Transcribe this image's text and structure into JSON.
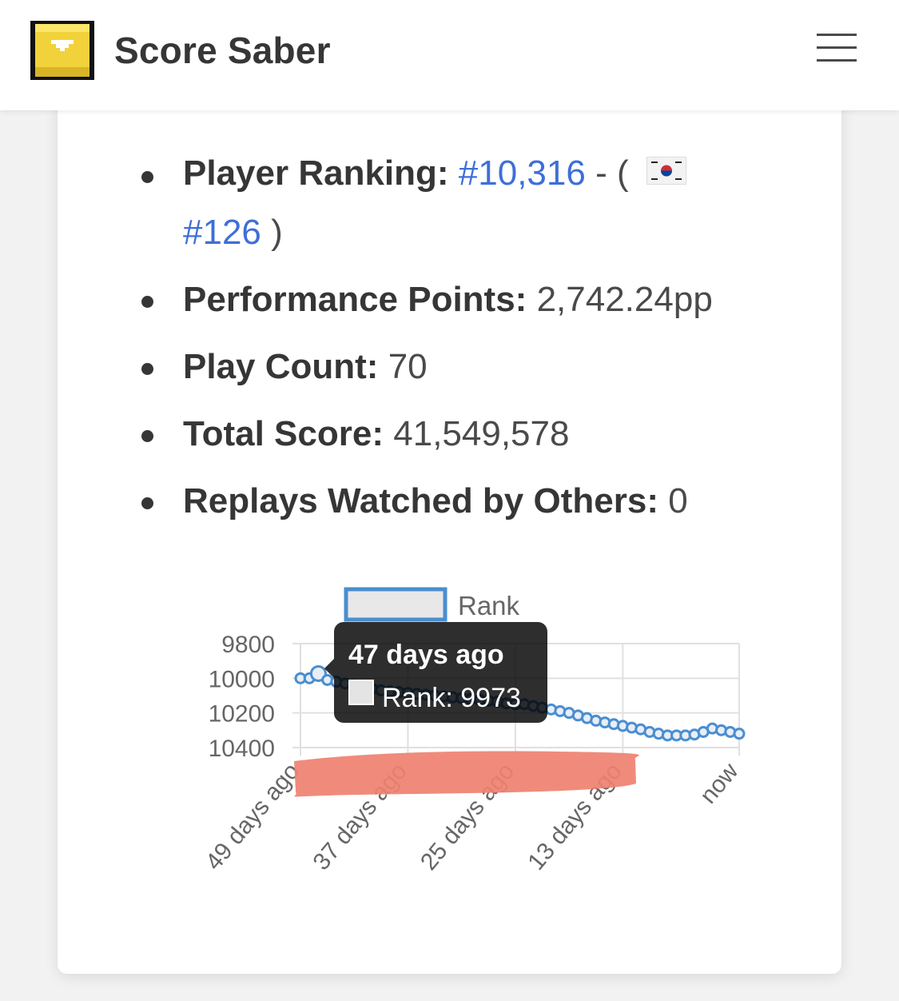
{
  "header": {
    "brand": "Score Saber",
    "logo_icon": "pixel-cube-logo-icon",
    "menu_icon": "hamburger-menu-icon"
  },
  "stats": {
    "player_ranking_label": "Player Ranking:",
    "player_ranking_value": "#10,316",
    "separator": " - ( ",
    "country_flag_icon": "south-korea-flag-icon",
    "country_rank_value": "#126",
    "country_rank_close": " )",
    "performance_points_label": "Performance Points:",
    "performance_points_value": "2,742.24pp",
    "play_count_label": "Play Count:",
    "play_count_value": "70",
    "total_score_label": "Total Score:",
    "total_score_value": "41,549,578",
    "replays_label": "Replays Watched by Others:",
    "replays_value": "0"
  },
  "chart_data": {
    "type": "line",
    "legend": "Rank",
    "y_reversed": true,
    "ylim": [
      9800,
      10400
    ],
    "y_ticks": [
      "9800",
      "10000",
      "10200",
      "10400"
    ],
    "x_ticks": [
      "49 days ago",
      "37 days ago",
      "25 days ago",
      "13 days ago",
      "now"
    ],
    "series": [
      {
        "name": "Rank",
        "color": "#4a8ed0",
        "x": [
          49,
          48,
          47,
          46,
          45,
          44,
          43,
          42,
          41,
          40,
          39,
          38,
          37,
          36,
          35,
          34,
          33,
          32,
          31,
          30,
          29,
          28,
          27,
          26,
          25,
          24,
          23,
          22,
          21,
          20,
          19,
          18,
          17,
          16,
          15,
          14,
          13,
          12,
          11,
          10,
          9,
          8,
          7,
          6,
          5,
          4,
          3,
          2,
          1,
          0
        ],
        "values": [
          10000,
          10000,
          9973,
          10010,
          10020,
          10030,
          10040,
          10050,
          10060,
          10070,
          10075,
          10080,
          10085,
          10090,
          10095,
          10100,
          10105,
          10110,
          10115,
          10120,
          10125,
          10130,
          10135,
          10145,
          10150,
          10150,
          10160,
          10170,
          10180,
          10190,
          10200,
          10215,
          10230,
          10245,
          10255,
          10265,
          10275,
          10285,
          10295,
          10310,
          10320,
          10330,
          10330,
          10330,
          10325,
          10310,
          10290,
          10300,
          10310,
          10320
        ]
      }
    ],
    "tooltip": {
      "title": "47 days ago",
      "body": "Rank: 9973"
    }
  }
}
